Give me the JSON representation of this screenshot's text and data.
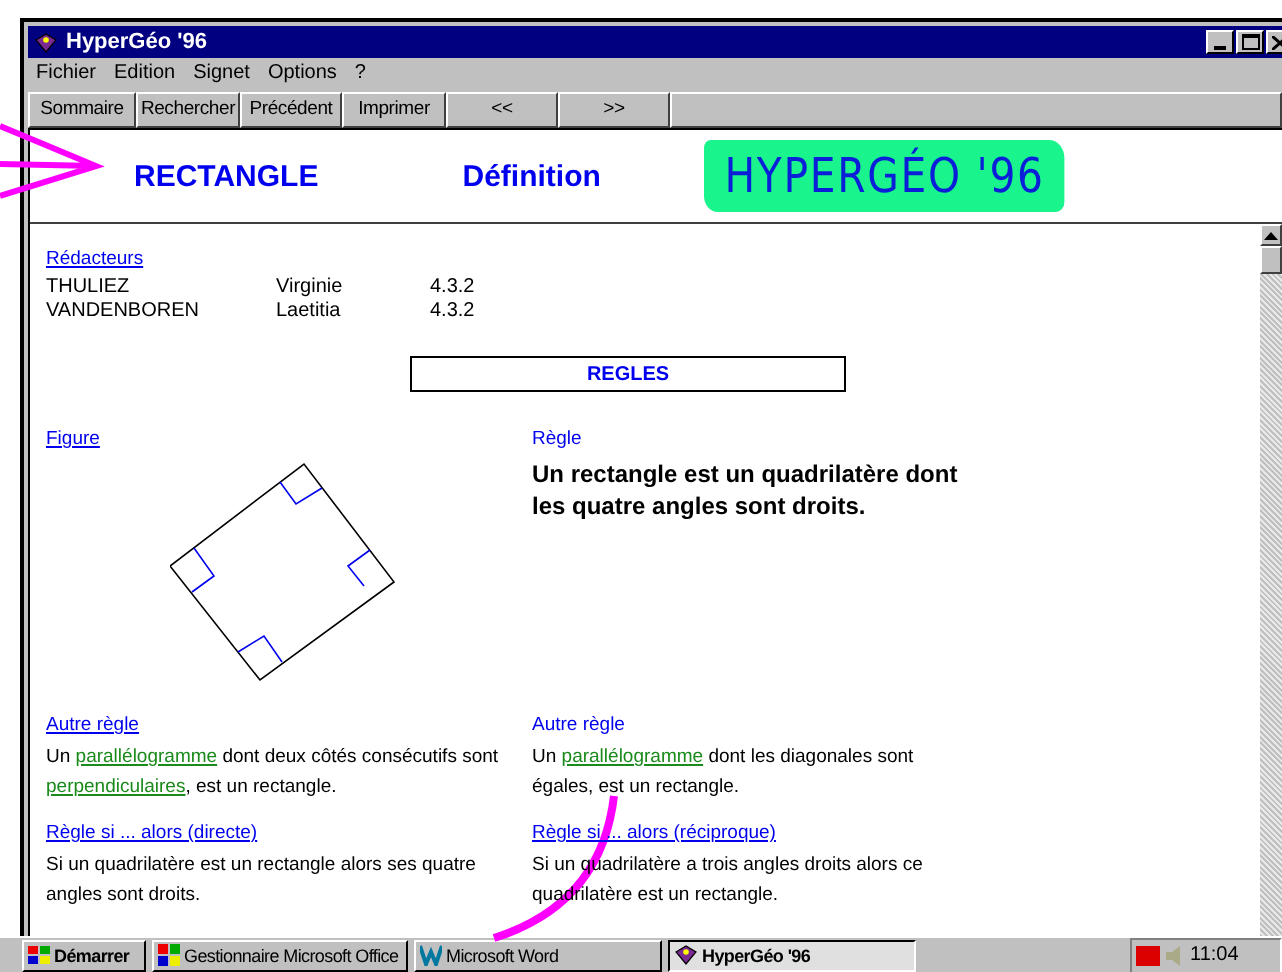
{
  "window": {
    "title": "HyperGéo '96"
  },
  "menu": [
    {
      "label": "Fichier"
    },
    {
      "label": "Edition"
    },
    {
      "label": "Signet"
    },
    {
      "label": "Options"
    },
    {
      "label": "?"
    }
  ],
  "toolbar": [
    {
      "label": "Sommaire"
    },
    {
      "label": "Rechercher"
    },
    {
      "label": "Précédent"
    },
    {
      "label": "Imprimer"
    },
    {
      "label": "<<"
    },
    {
      "label": ">>"
    }
  ],
  "header": {
    "title": "RECTANGLE",
    "section": "Définition",
    "logo": "HYPERGÉO '96"
  },
  "redacteurs": {
    "label": "Rédacteurs",
    "rows": [
      {
        "last": "THULIEZ",
        "first": "Virginie",
        "version": "4.3.2"
      },
      {
        "last": "VANDENBOREN",
        "first": "Laetitia",
        "version": "4.3.2"
      }
    ]
  },
  "regles_heading": "REGLES",
  "figure_label": "Figure",
  "rule": {
    "label": "Règle",
    "text": "Un rectangle est un quadrilatère dont les quatre angles sont droits."
  },
  "blocks": [
    {
      "label": "Autre règle",
      "link": true,
      "segments": [
        {
          "text": "Un ",
          "link": false
        },
        {
          "text": "parallélogramme",
          "link": true
        },
        {
          "text": " dont deux côtés consécutifs sont ",
          "link": false
        },
        {
          "text": "perpendiculaires",
          "link": true
        },
        {
          "text": ", est un rectangle.",
          "link": false
        }
      ]
    },
    {
      "label": "Autre règle",
      "link": false,
      "segments": [
        {
          "text": "Un ",
          "link": false
        },
        {
          "text": "parallélogramme",
          "link": true
        },
        {
          "text": " dont les diagonales sont égales, est un rectangle.",
          "link": false
        }
      ]
    },
    {
      "label": "Règle si ... alors (directe)",
      "link": true,
      "segments": [
        {
          "text": "Si un quadrilatère est un rectangle alors ses quatre angles sont droits.",
          "link": false
        }
      ]
    },
    {
      "label": "Règle si ... alors (réciproque)",
      "link": true,
      "segments": [
        {
          "text": "Si un quadrilatère a trois angles droits alors ce quadrilatère est un rectangle.",
          "link": false
        }
      ]
    }
  ],
  "taskbar": {
    "start": "Démarrer",
    "tasks": [
      {
        "label": "Gestionnaire Microsoft Office",
        "kind": "office",
        "selected": false
      },
      {
        "label": "Microsoft Word",
        "kind": "word",
        "selected": false
      },
      {
        "label": "HyperGéo '96",
        "kind": "app",
        "selected": true
      }
    ],
    "clock": "11:04"
  }
}
